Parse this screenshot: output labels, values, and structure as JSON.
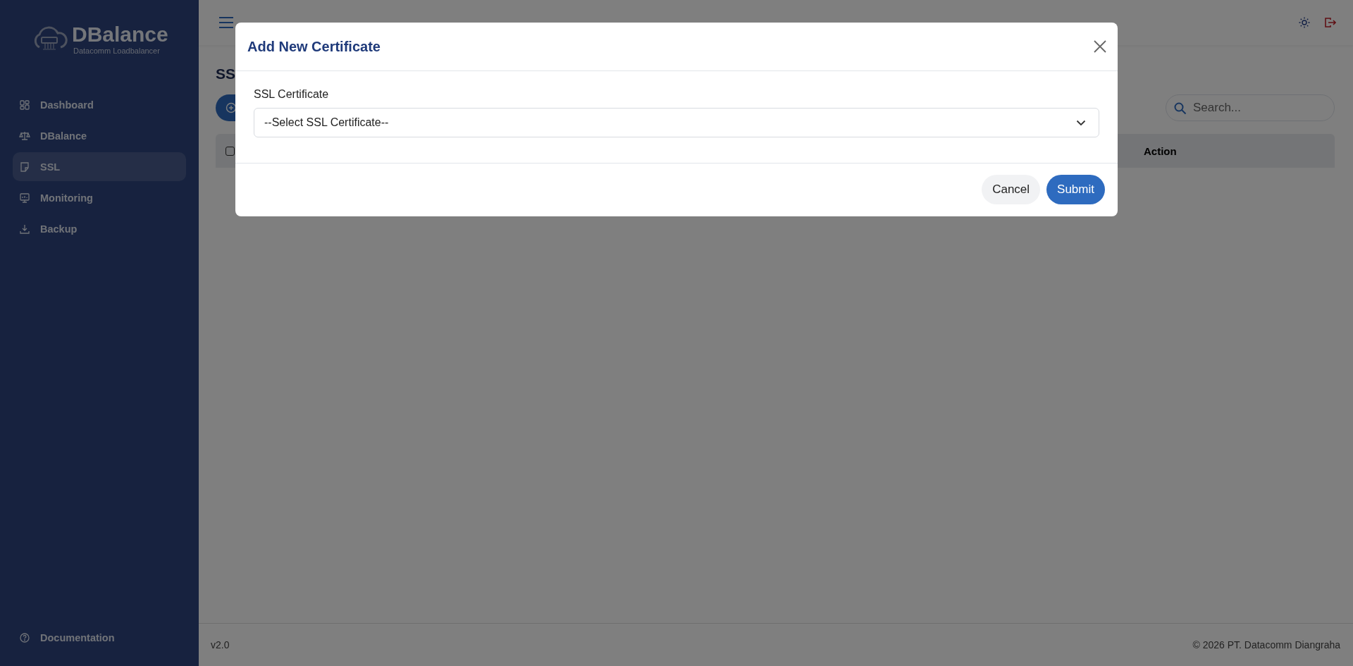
{
  "sidebar": {
    "brand": {
      "name": "DBalance",
      "tagline": "Datacomm Loadbalancer"
    },
    "items": [
      {
        "label": "Dashboard",
        "selected": false
      },
      {
        "label": "DBalance",
        "selected": false
      },
      {
        "label": "SSL",
        "selected": true
      },
      {
        "label": "Monitoring",
        "selected": false
      },
      {
        "label": "Backup",
        "selected": false
      }
    ],
    "footer_link": "Documentation"
  },
  "page": {
    "title": "SS",
    "search": {
      "placeholder": "Search..."
    },
    "table": {
      "select_all_checked": false,
      "columns": [
        "Action"
      ]
    }
  },
  "modal": {
    "title": "Add New Certificate",
    "field_label": "SSL Certificate",
    "select_value": "--Select SSL Certificate--",
    "buttons": [
      {
        "label": "Cancel",
        "kind": "secondary"
      },
      {
        "label": "Submit",
        "kind": "primary"
      }
    ]
  },
  "footer": {
    "version": "v2.0",
    "copyright": "© 2026 PT. Datacomm Diangraha"
  }
}
